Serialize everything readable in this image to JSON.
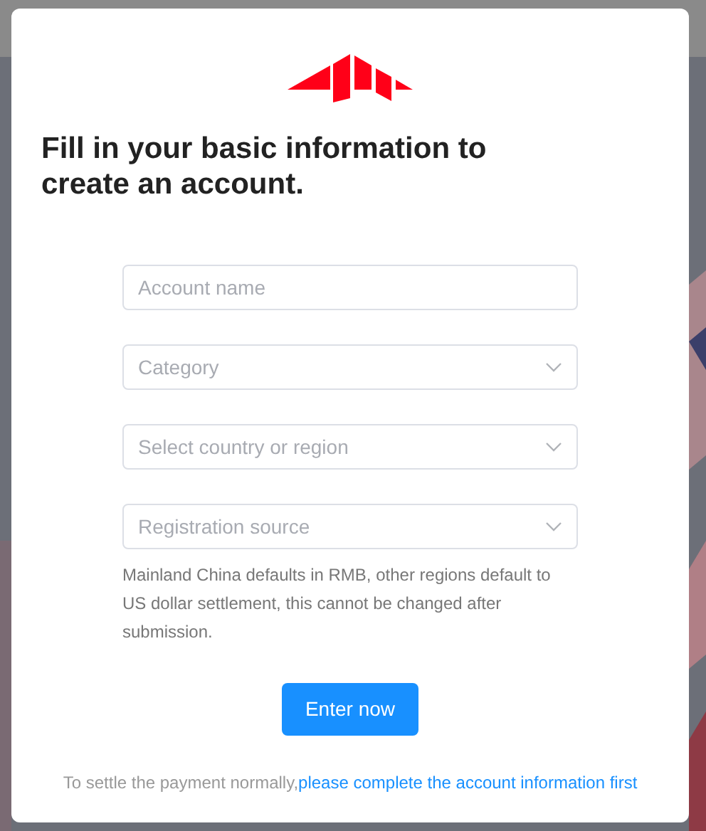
{
  "dialog": {
    "title": "Fill in your basic information to create an account.",
    "fields": [
      {
        "kind": "text",
        "placeholder": "Account name"
      },
      {
        "kind": "select",
        "placeholder": "Category"
      },
      {
        "kind": "select",
        "placeholder": "Select country or region"
      },
      {
        "kind": "select",
        "placeholder": "Registration source"
      }
    ],
    "note": "Mainland China defaults in RMB, other regions default to US dollar settlement, this cannot be changed after submission.",
    "button": "Enter now",
    "footer": {
      "text": "To settle the payment normally,",
      "link": "please complete the account information first"
    }
  }
}
